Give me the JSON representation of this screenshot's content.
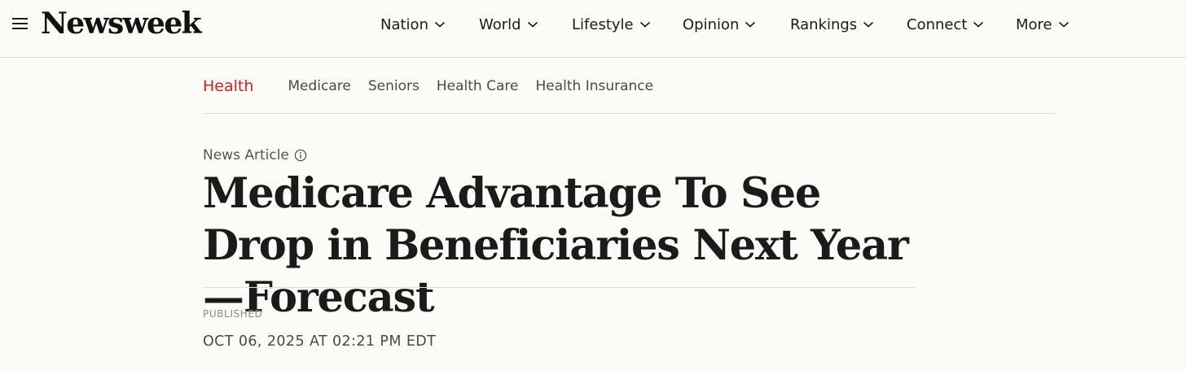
{
  "header": {
    "logo": "Newsweek",
    "nav": [
      {
        "label": "Nation"
      },
      {
        "label": "World"
      },
      {
        "label": "Lifestyle"
      },
      {
        "label": "Opinion"
      },
      {
        "label": "Rankings"
      },
      {
        "label": "Connect"
      },
      {
        "label": "More"
      }
    ]
  },
  "section_nav": {
    "active": "Health",
    "items": [
      "Medicare",
      "Seniors",
      "Health Care",
      "Health Insurance"
    ]
  },
  "article": {
    "kicker": "News Article",
    "headline": "Medicare Advantage To See Drop in Beneficiaries Next Year—Forecast",
    "published_label": "PUBLISHED",
    "published_date": "OCT 06, 2025 AT 02:21 PM EDT"
  },
  "icons": {
    "menu": "hamburger-menu-icon",
    "dropdown": "chevron-down-icon",
    "info": "info-circle-icon"
  },
  "colors": {
    "background": "#fcfbf7",
    "accent": "#d2241f",
    "text": "#1b1b1b",
    "divider": "#e2ded0"
  }
}
